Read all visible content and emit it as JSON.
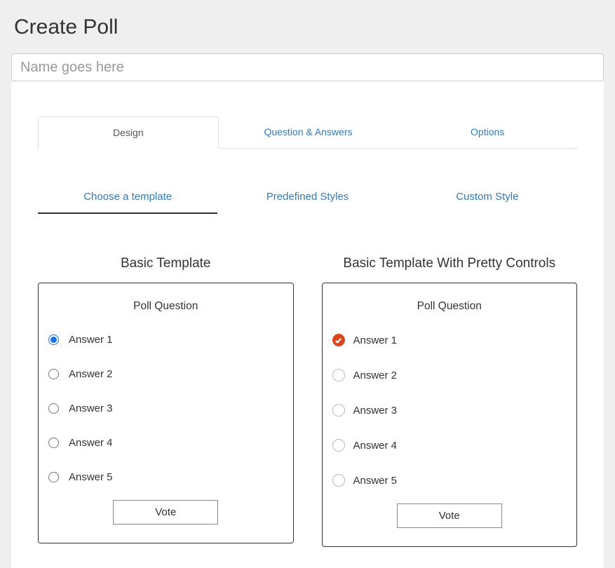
{
  "header": {
    "title": "Create Poll"
  },
  "name_input": {
    "placeholder": "Name goes here",
    "value": ""
  },
  "tabs_outer": [
    {
      "label": "Design",
      "active": true
    },
    {
      "label": "Question & Answers",
      "active": false
    },
    {
      "label": "Options",
      "active": false
    }
  ],
  "tabs_inner": [
    {
      "label": "Choose a template",
      "active": true
    },
    {
      "label": "Predefined Styles",
      "active": false
    },
    {
      "label": "Custom Style",
      "active": false
    }
  ],
  "templates": [
    {
      "title": "Basic Template",
      "question": "Poll Question",
      "answers": [
        "Answer 1",
        "Answer 2",
        "Answer 3",
        "Answer 4",
        "Answer 5"
      ],
      "selected": 0,
      "style": "native",
      "vote_label": "Vote"
    },
    {
      "title": "Basic Template With Pretty Controls",
      "question": "Poll Question",
      "answers": [
        "Answer 1",
        "Answer 2",
        "Answer 3",
        "Answer 4",
        "Answer 5"
      ],
      "selected": 0,
      "style": "pretty",
      "vote_label": "Vote"
    }
  ]
}
